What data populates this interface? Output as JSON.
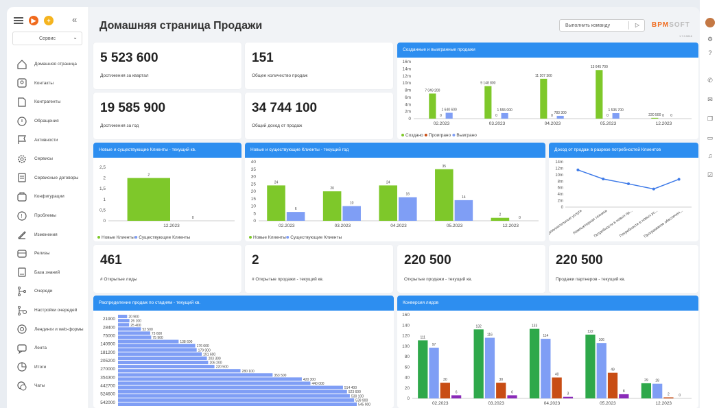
{
  "app": {
    "title": "Домашняя страница Продажи",
    "command_placeholder": "Выполнить команду",
    "logo": "BPMSOFT",
    "version": "1.7.0.5616"
  },
  "sidebar": {
    "selector": "Сервис",
    "items": [
      {
        "label": "Домашняя страница",
        "icon": "home-icon"
      },
      {
        "label": "Контакты",
        "icon": "contact-icon"
      },
      {
        "label": "Контрагенты",
        "icon": "account-icon"
      },
      {
        "label": "Обращения",
        "icon": "case-icon"
      },
      {
        "label": "Активности",
        "icon": "flag-icon"
      },
      {
        "label": "Сервисы",
        "icon": "gear-icon"
      },
      {
        "label": "Сервисные договоры",
        "icon": "contract-icon"
      },
      {
        "label": "Конфигурации",
        "icon": "config-icon"
      },
      {
        "label": "Проблемы",
        "icon": "problem-icon"
      },
      {
        "label": "Изменения",
        "icon": "pen-icon"
      },
      {
        "label": "Релизы",
        "icon": "release-icon"
      },
      {
        "label": "База знаний",
        "icon": "book-icon"
      },
      {
        "label": "Очереди",
        "icon": "queue-icon"
      },
      {
        "label": "Настройки очередей",
        "icon": "queue-settings-icon"
      },
      {
        "label": "Лендинги и web-формы",
        "icon": "target-icon"
      },
      {
        "label": "Лента",
        "icon": "feed-icon"
      },
      {
        "label": "Итоги",
        "icon": "pie-icon"
      },
      {
        "label": "Чаты",
        "icon": "chat-icon"
      }
    ]
  },
  "kpis": [
    {
      "value": "5 523 600",
      "label": "Достижения за квартал"
    },
    {
      "value": "151",
      "label": "Общее количество продаж"
    },
    {
      "value": "19 585 900",
      "label": "Достижения за год"
    },
    {
      "value": "34 744 100",
      "label": "Общий доход от продаж"
    },
    {
      "value": "461",
      "label": "# Открытые лиды"
    },
    {
      "value": "2",
      "label": "# Открытые продажи - текущий кв."
    },
    {
      "value": "220 500",
      "label": "Открытые продажи - текущий кв."
    },
    {
      "value": "220 500",
      "label": "Продажи партнеров - текущий кв."
    }
  ],
  "chart_data": [
    {
      "type": "bar",
      "title": "Созданные и выигранные продажи",
      "categories": [
        "02.2023",
        "03.2023",
        "04.2023",
        "05.2023",
        "12.2023"
      ],
      "yticks": [
        "0",
        "2m",
        "4m",
        "6m",
        "8m",
        "10m",
        "12m",
        "14m",
        "16m"
      ],
      "ylim": [
        0,
        16
      ],
      "series": [
        {
          "name": "Создано",
          "color": "#7ec82a",
          "values": [
            7.0492,
            9.1488,
            11.207,
            13.6457,
            0.2205
          ],
          "labels": [
            "7 049 200",
            "9 148 800",
            "11 207 300",
            "13 645 700",
            "220 500"
          ]
        },
        {
          "name": "Проиграно",
          "color": "#c84d14",
          "values": [
            0,
            0,
            0,
            0,
            0
          ],
          "labels": [
            "0",
            "0",
            "0",
            "0",
            "0"
          ]
        },
        {
          "name": "Выиграно",
          "color": "#7f9ef5",
          "values": [
            1.6406,
            1.555,
            0.7833,
            1.5357,
            0
          ],
          "labels": [
            "1 640 600",
            "1 555 000",
            "783 300",
            "1 535 700",
            "0"
          ]
        }
      ]
    },
    {
      "type": "bar",
      "title": "Новые и существующие Клиенты - текущий кв.",
      "categories": [
        "12.2023"
      ],
      "yticks": [
        "0",
        "0,5",
        "1",
        "1,5",
        "2",
        "2,5"
      ],
      "ylim": [
        0,
        2.5
      ],
      "series": [
        {
          "name": "Новые Клиенты",
          "color": "#7ec82a",
          "values": [
            2
          ],
          "labels": [
            "2"
          ]
        },
        {
          "name": "Существующие Клиенты",
          "color": "#7f9ef5",
          "values": [
            0
          ],
          "labels": [
            "0"
          ]
        }
      ]
    },
    {
      "type": "bar",
      "title": "Новые и существующие Клиенты - текущий год",
      "categories": [
        "02.2023",
        "03.2023",
        "04.2023",
        "05.2023",
        "12.2023"
      ],
      "yticks": [
        "0",
        "5",
        "10",
        "15",
        "20",
        "25",
        "30",
        "35",
        "40"
      ],
      "ylim": [
        0,
        40
      ],
      "series": [
        {
          "name": "Новые Клиенты",
          "color": "#7ec82a",
          "values": [
            24,
            20,
            24,
            35,
            2
          ],
          "labels": [
            "24",
            "20",
            "24",
            "35",
            "2"
          ]
        },
        {
          "name": "Существующие Клиенты",
          "color": "#7f9ef5",
          "values": [
            6,
            10,
            16,
            14,
            0
          ],
          "labels": [
            "6",
            "10",
            "16",
            "14",
            "0"
          ]
        }
      ]
    },
    {
      "type": "line",
      "title": "Доход от продаж в разрезе потребностей Клиентов",
      "categories": [
        "Дополнительные услуги",
        "Компьютерная техника",
        "Потребности в новых пр...",
        "Потребности в новых ус...",
        "Программное обеспечен..."
      ],
      "yticks": [
        "0",
        "2m",
        "4m",
        "6m",
        "8m",
        "10m",
        "12m",
        "14m"
      ],
      "ylim": [
        0,
        14
      ],
      "series": [
        {
          "name": "",
          "color": "#3f7be8",
          "values": [
            11.5,
            8.7,
            7.2,
            5.6,
            8.6
          ]
        }
      ]
    },
    {
      "type": "bar",
      "orientation": "horizontal",
      "title": "Распределение продаж по стадиям - текущий кв.",
      "categories": [
        "21900",
        "28400",
        "75000",
        "140900",
        "181200",
        "205200",
        "270000",
        "354300",
        "442700",
        "524600",
        "542000"
      ],
      "series": [
        {
          "name": "",
          "color": "#7f9ef5",
          "values": [
            20900,
            26100,
            25400,
            52500,
            73600,
            75900,
            138600,
            176600,
            179900,
            191600,
            203300,
            206200,
            220500,
            280100,
            353500,
            420300,
            440000,
            514400,
            523600,
            530100,
            539900,
            545900
          ],
          "labels": [
            "20 900",
            "26 100",
            "25 400",
            "52 500",
            "73 600",
            "75 900",
            "138 600",
            "176 600",
            "179 900",
            "191 600",
            "203 300",
            "206 200",
            "220 500",
            "280 100",
            "353 500",
            "420 300",
            "440 000",
            "514 400",
            "523 600",
            "530 100",
            "539 900",
            "545 900"
          ]
        }
      ]
    },
    {
      "type": "bar",
      "title": "Конверсия лидов",
      "categories": [
        "02.2023",
        "03.2023",
        "04.2023",
        "05.2023",
        "12.2023"
      ],
      "yticks": [
        "0",
        "20",
        "40",
        "60",
        "80",
        "100",
        "120",
        "140",
        "160"
      ],
      "ylim": [
        0,
        160
      ],
      "series": [
        {
          "name": "",
          "color": "#2ea84a",
          "values": [
            111,
            132,
            133,
            122,
            29
          ]
        },
        {
          "name": "",
          "color": "#7f9ef5",
          "values": [
            97,
            116,
            114,
            106,
            28
          ]
        },
        {
          "name": "",
          "color": "#c84d14",
          "values": [
            30,
            30,
            40,
            49,
            2
          ]
        },
        {
          "name": "",
          "color": "#8a2bb8",
          "values": [
            6,
            6,
            3,
            8,
            0
          ]
        }
      ]
    }
  ]
}
